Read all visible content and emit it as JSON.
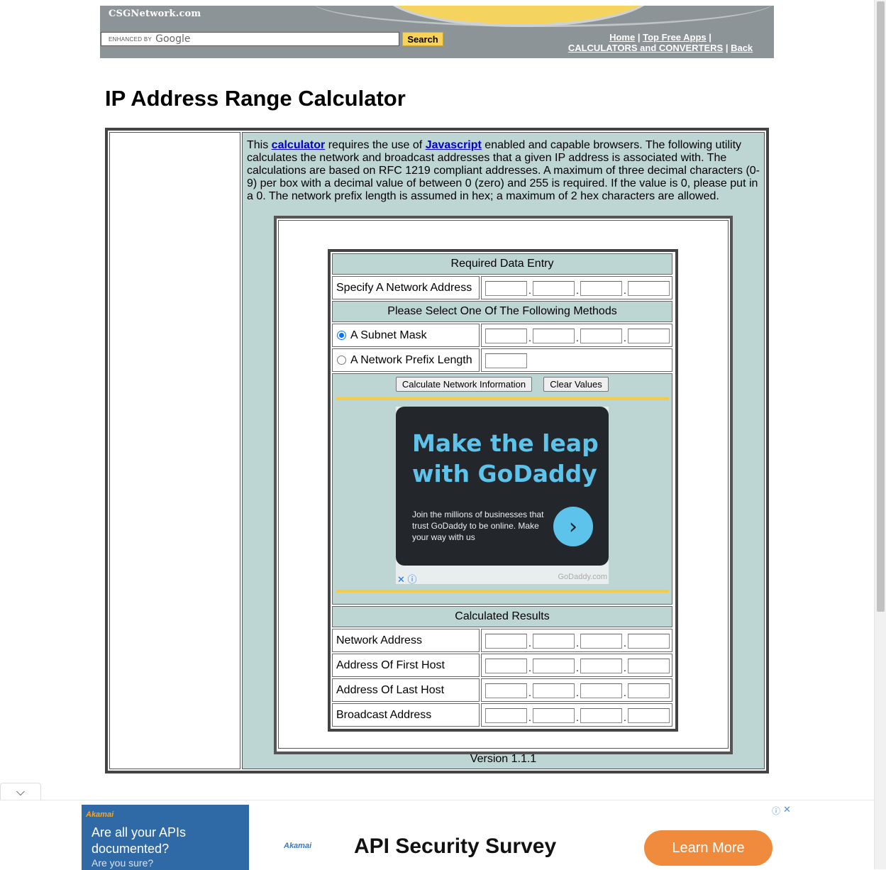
{
  "header": {
    "logo": "CSGNetwork.com",
    "search_enhanced": "ENHANCED BY",
    "search_brand": "Google",
    "search_button": "Search",
    "links": {
      "home": "Home",
      "top_free_apps": "Top Free Apps",
      "calculators": "CALCULATORS and CONVERTERS",
      "back": "Back"
    },
    "separator": "|"
  },
  "page_title": "IP Address Range Calculator",
  "intro": {
    "p1": "This ",
    "link1": "calculator",
    "p2": " requires the use of ",
    "link2": "Javascript",
    "p3": " enabled and capable browsers. The following utility calculates the network and broadcast addresses that a given IP address is associated with. The calculations are based on RFC 1219 compliant addresses. A maximum of three decimal characters (0-9) per box with a decimal value of between 0 (zero) and 255 is required. If the value is 0, please put in a 0. The network prefix length is assumed in hex; a maximum of 2 hex characters are allowed."
  },
  "calculator": {
    "required_header": "Required Data Entry",
    "network_address_label": "Specify A Network Address",
    "methods_header": "Please Select One Of The Following Methods",
    "subnet_mask_label": "A Subnet Mask",
    "prefix_length_label": "A Network Prefix Length",
    "subnet_mask_selected": true,
    "calculate_button": "Calculate Network Information",
    "clear_button": "Clear Values",
    "results_header": "Calculated Results",
    "results": [
      {
        "label": "Network Address"
      },
      {
        "label": "Address Of First Host"
      },
      {
        "label": "Address Of Last Host"
      },
      {
        "label": "Broadcast Address"
      }
    ],
    "octet_separator": "."
  },
  "ad_godaddy": {
    "headline": "Make the leap with GoDaddy",
    "body": "Join the millions of businesses that trust GoDaddy to be online. Make your way with us",
    "brand": "GoDaddy.com",
    "arrow_icon": "chevron-right-icon"
  },
  "version": "Version 1.1.1",
  "bottom_ad": {
    "brand": "Akamai",
    "question": "Are all your APIs documented?",
    "sub": "Are you sure?",
    "headline": "API Security Survey",
    "cta": "Learn More"
  },
  "colors": {
    "teal": "#bdd5d3",
    "accent_yellow": "#f2cb4d",
    "header_gray": "#8c9497",
    "link_blue": "#0000cc",
    "cta_orange": "#f08a3c"
  }
}
